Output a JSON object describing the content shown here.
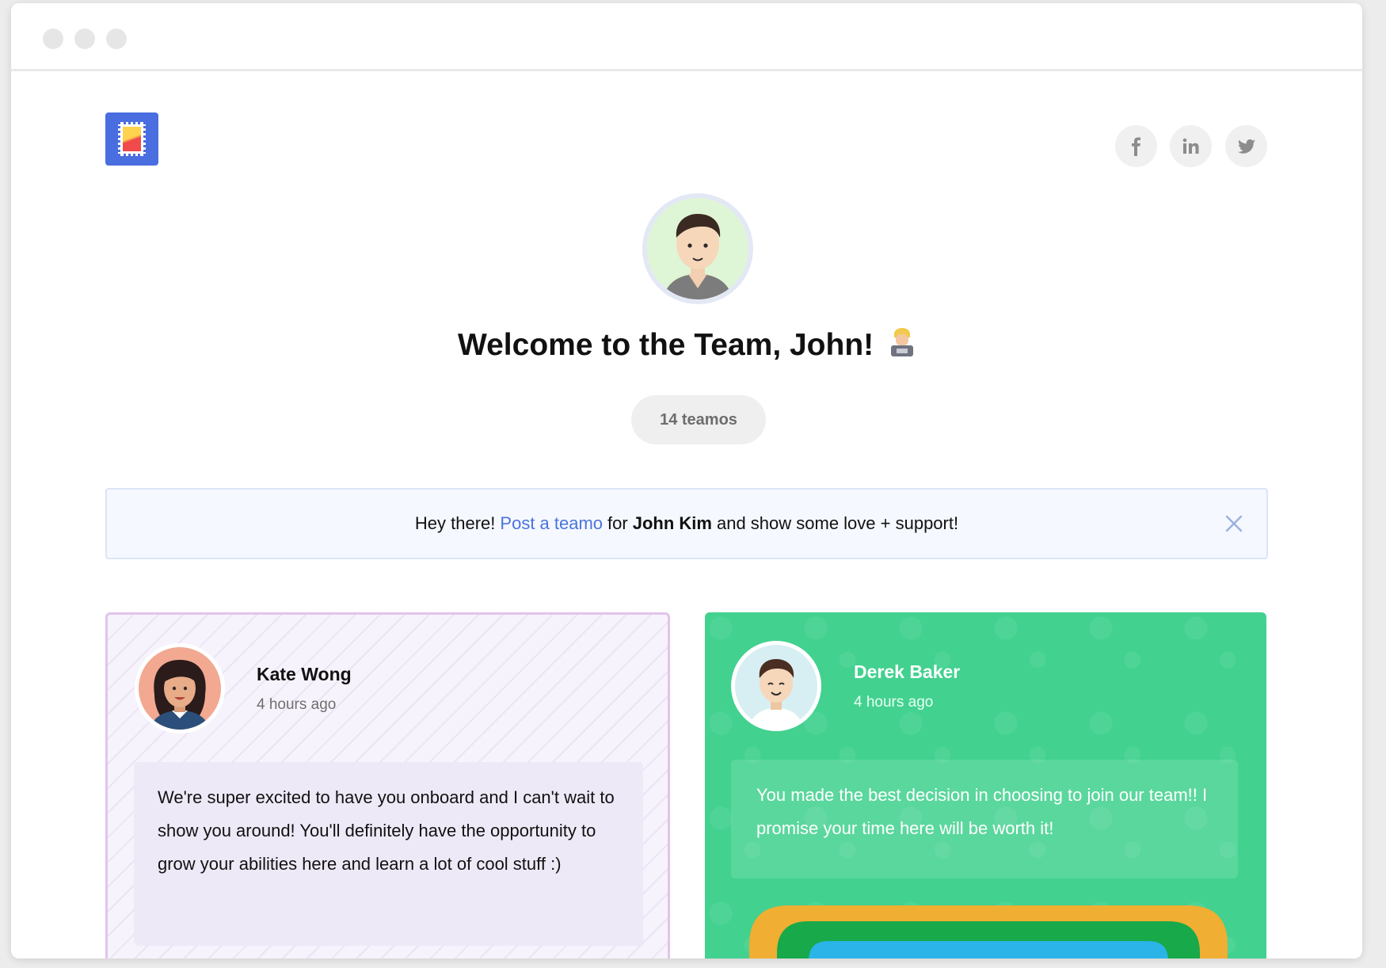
{
  "window": {
    "controls": [
      "close",
      "minimize",
      "maximize"
    ]
  },
  "header": {
    "logo_icon": "stamp-logo-icon",
    "social": [
      {
        "name": "facebook",
        "icon": "facebook-icon"
      },
      {
        "name": "linkedin",
        "icon": "linkedin-icon"
      },
      {
        "name": "twitter",
        "icon": "twitter-icon"
      }
    ]
  },
  "hero": {
    "title": "Welcome to the Team, John!",
    "title_emoji_icon": "technologist-emoji-icon",
    "count_label": "14 teamos"
  },
  "banner": {
    "prefix": "Hey there!",
    "link_text": "Post a teamo",
    "mid": "for",
    "name": "John Kim",
    "suffix": "and show some love + support!",
    "close_icon": "close-icon",
    "link_color": "#4a74dc"
  },
  "posts": [
    {
      "author": "Kate Wong",
      "time": "4 hours ago",
      "message": "We're super excited to have you onboard and I can't wait to show you around! You'll definitely have the opportunity to grow your abilities here and learn a lot of cool stuff :)",
      "theme_color": "#f7f3fc"
    },
    {
      "author": "Derek Baker",
      "time": "4 hours ago",
      "message": "You made the best decision in choosing to join our team!! I promise your time here will be worth it!",
      "theme_color": "#42d18f"
    }
  ]
}
